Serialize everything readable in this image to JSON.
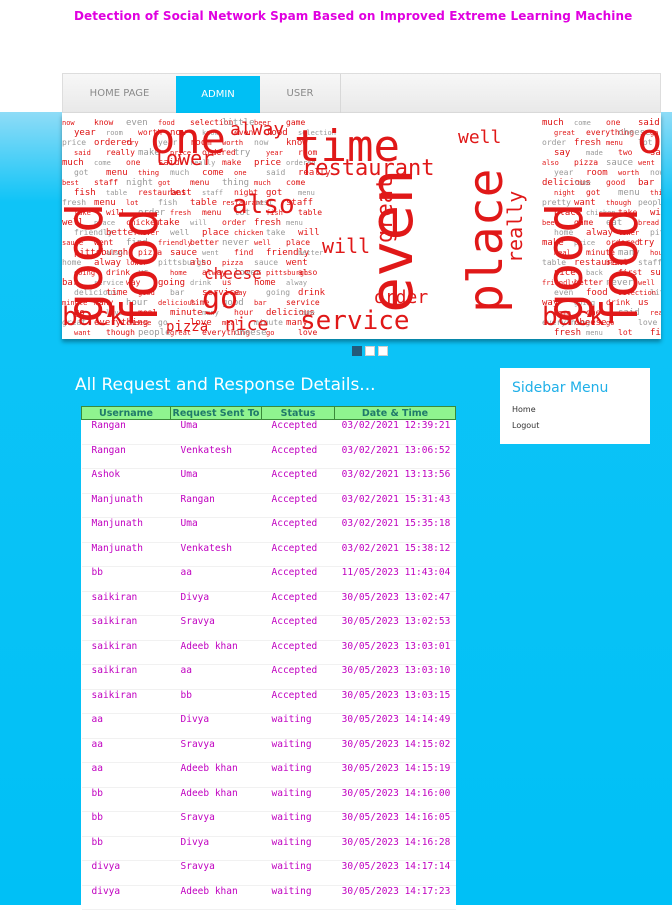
{
  "site": {
    "title": "Detection of Social Network Spam Based on Improved Extreme Learning Machine"
  },
  "nav": {
    "items": [
      "HOME PAGE",
      "ADMIN",
      "USER"
    ],
    "active": "ADMIN"
  },
  "slider": {
    "dots": 3,
    "active_dot": 1,
    "words": [
      "now",
      "never",
      "though",
      "one",
      "alway",
      "made",
      "table",
      "delicious",
      "know",
      "well",
      "people",
      "said",
      "lower",
      "two",
      "restaurant",
      "time",
      "even",
      "place",
      "great",
      "really",
      "pittsburgh",
      "salad",
      "best",
      "good",
      "food",
      "chicken",
      "everything",
      "make",
      "also",
      "day",
      "staff",
      "bar",
      "selection",
      "take",
      "cheese",
      "price",
      "pizza",
      "nice",
      "night",
      "service",
      "little",
      "will",
      "go",
      "ordered",
      "sauce",
      "back",
      "got",
      "way",
      "beer",
      "order",
      "love",
      "try",
      "went",
      "first",
      "menu",
      "going",
      "game",
      "fresh",
      "meal",
      "year",
      "find",
      "sure",
      "thing",
      "drink",
      "eat",
      "menu",
      "minute",
      "room",
      "friendly",
      "pretty",
      "much",
      "us",
      "bread",
      "lot",
      "many",
      "worth",
      "better",
      "want",
      "come",
      "home",
      "say",
      "fish",
      "hour"
    ]
  },
  "content": {
    "title": "All Request and Response Details...",
    "columns": [
      "Username",
      "Request Sent To",
      "Status",
      "Date & Time"
    ],
    "rows": [
      [
        "Rangan",
        "Uma",
        "Accepted",
        "03/02/2021 12:39:21"
      ],
      [
        "Rangan",
        "Venkatesh",
        "Accepted",
        "03/02/2021 13:06:52"
      ],
      [
        "Ashok",
        "Uma",
        "Accepted",
        "03/02/2021 13:13:56"
      ],
      [
        "Manjunath",
        "Rangan",
        "Accepted",
        "03/02/2021 15:31:43"
      ],
      [
        "Manjunath",
        "Uma",
        "Accepted",
        "03/02/2021 15:35:18"
      ],
      [
        "Manjunath",
        "Venkatesh",
        "Accepted",
        "03/02/2021 15:38:12"
      ],
      [
        "bb",
        "aa",
        "Accepted",
        "11/05/2023 11:43:04"
      ],
      [
        "saikiran",
        "Divya",
        "Accepted",
        "30/05/2023 13:02:47"
      ],
      [
        "saikiran",
        "Sravya",
        "Accepted",
        "30/05/2023 13:02:53"
      ],
      [
        "saikiran",
        "Adeeb khan",
        "Accepted",
        "30/05/2023 13:03:01"
      ],
      [
        "saikiran",
        "aa",
        "Accepted",
        "30/05/2023 13:03:10"
      ],
      [
        "saikiran",
        "bb",
        "Accepted",
        "30/05/2023 13:03:15"
      ],
      [
        "aa",
        "Divya",
        "waiting",
        "30/05/2023 14:14:49"
      ],
      [
        "aa",
        "Sravya",
        "waiting",
        "30/05/2023 14:15:02"
      ],
      [
        "aa",
        "Adeeb khan",
        "waiting",
        "30/05/2023 14:15:19"
      ],
      [
        "bb",
        "Adeeb khan",
        "waiting",
        "30/05/2023 14:16:00"
      ],
      [
        "bb",
        "Sravya",
        "waiting",
        "30/05/2023 14:16:05"
      ],
      [
        "bb",
        "Divya",
        "waiting",
        "30/05/2023 14:16:28"
      ],
      [
        "divya",
        "Sravya",
        "waiting",
        "30/05/2023 14:17:14"
      ],
      [
        "divya",
        "Adeeb khan",
        "waiting",
        "30/05/2023 14:17:23"
      ]
    ]
  },
  "sidebar": {
    "title": "Sidebar Menu",
    "links": [
      "Home",
      "Logout"
    ]
  },
  "colors": {
    "accent": "#00bff4",
    "title": "#e000e0",
    "word_red": "#e01818",
    "header_green": "#8ff48f"
  }
}
